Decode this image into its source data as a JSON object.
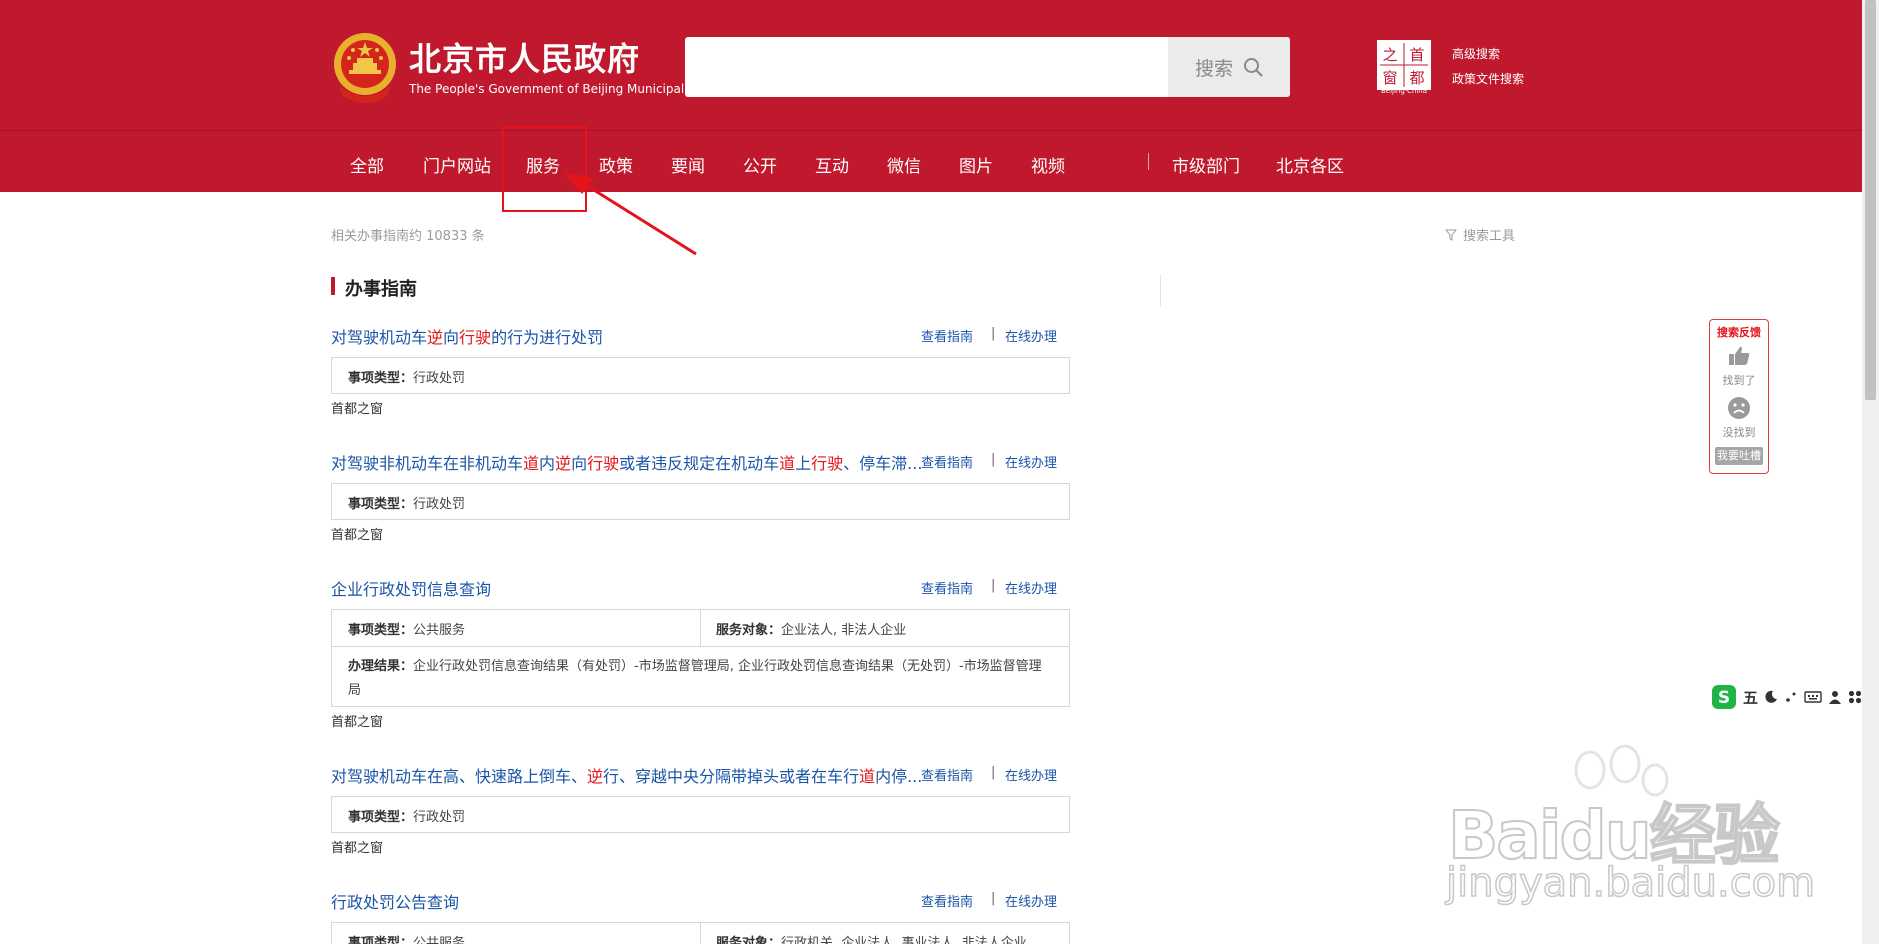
{
  "header": {
    "title": "北京市人民政府",
    "subtitle": "The People's Government of Beijing Municipality",
    "search_placeholder": "",
    "search_button": "搜索",
    "capital_logo_chars": [
      "之",
      "首",
      "窗",
      "都"
    ],
    "capital_logo_caption": "Beijing·China",
    "advanced_search": "高级搜索",
    "policy_search": "政策文件搜索",
    "colors": {
      "brand_red": "#c0192e",
      "link_blue": "#1b55a8",
      "highlight_red": "#e4141c"
    }
  },
  "nav": {
    "items": [
      "全部",
      "门户网站",
      "服务",
      "政策",
      "要闻",
      "公开",
      "互动",
      "微信",
      "图片",
      "视频"
    ],
    "extra_items": [
      "市级部门",
      "北京各区"
    ],
    "annotated_item": "服务"
  },
  "content": {
    "result_count": "相关办事指南约 10833 条",
    "search_tools": "搜索工具",
    "section_title": "办事指南",
    "link_view_guide": "查看指南",
    "link_online": "在线办理",
    "link_separator": "|",
    "results": [
      {
        "title_parts": [
          "对驾驶机动车",
          "逆",
          "向",
          "行驶",
          "的行为进行处罚"
        ],
        "rows": [
          [
            [
              "事项类型：",
              "行政处罚"
            ]
          ]
        ],
        "source": "首都之窗"
      },
      {
        "title_parts": [
          "对驾驶非机动车在非机动车",
          "道",
          "内",
          "逆",
          "向",
          "行驶",
          "或者违反规定在机动车",
          "道",
          "上",
          "行驶",
          "、停车滞..."
        ],
        "rows": [
          [
            [
              "事项类型：",
              "行政处罚"
            ]
          ]
        ],
        "source": "首都之窗"
      },
      {
        "title_parts": [
          "企业行政处罚信息查询"
        ],
        "rows": [
          [
            [
              "事项类型：",
              "公共服务"
            ],
            [
              "服务对象：",
              "企业法人, 非法人企业"
            ]
          ],
          [
            [
              "办理结果：",
              "企业行政处罚信息查询结果（有处罚）-市场监督管理局, 企业行政处罚信息查询结果（无处罚）-市场监督管理局"
            ]
          ]
        ],
        "source": "首都之窗"
      },
      {
        "title_parts": [
          "对驾驶机动车在高、快速路上倒车、",
          "逆",
          "行、穿越中央分隔带掉头或者在车行",
          "道",
          "内停..."
        ],
        "rows": [
          [
            [
              "事项类型：",
              "行政处罚"
            ]
          ]
        ],
        "source": "首都之窗"
      },
      {
        "title_parts": [
          "行政处罚公告查询"
        ],
        "rows": [
          [
            [
              "事项类型：",
              "公共服务"
            ],
            [
              "服务对象：",
              "行政机关, 企业法人, 事业法人, 非法人企业,"
            ]
          ]
        ],
        "source": ""
      }
    ]
  },
  "feedback": {
    "title": "搜索反馈",
    "found": "找到了",
    "not_found": "没找到",
    "complain": "我要吐槽"
  },
  "ime": {
    "mode": "五"
  },
  "watermark": {
    "brand": "Baidu经验",
    "url": "jingyan.baidu.com"
  }
}
